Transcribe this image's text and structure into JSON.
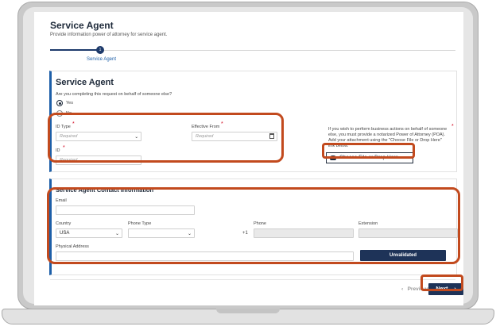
{
  "page": {
    "title": "Service Agent",
    "subtitle": "Provide information power of attorney for service agent."
  },
  "stepper": {
    "step_number": "1",
    "step_label": "Service Agent"
  },
  "service_agent": {
    "title": "Service Agent",
    "question": "Are you completing this request on behalf of someone else?",
    "option_yes": "Yes",
    "option_no": "No",
    "selected": "Yes",
    "id_type_label": "ID Type",
    "id_type_placeholder": "Required",
    "effective_from_label": "Effective From",
    "effective_from_placeholder": "Required",
    "id_label": "ID",
    "id_placeholder": "Required",
    "poa_text": "If you wish to perform business actions on behalf of someone else, you must provide a notarized Power of Attorney (POA). Add your attachment using the \"Choose File or Drop Here\" link below.",
    "upload_label": "Choose File or Drop Here",
    "required_mark": "*"
  },
  "contact": {
    "title": "Service Agent Contact Information",
    "email_label": "Email",
    "country_label": "Country",
    "country_value": "USA",
    "phone_type_label": "Phone Type",
    "phone_prefix": "+1",
    "phone_label": "Phone",
    "extension_label": "Extension",
    "address_label": "Physical Address",
    "unvalidated_label": "Unvalidated"
  },
  "footer": {
    "previous_label": "Previous",
    "next_label": "Next"
  },
  "colors": {
    "accent": "#1d5fa8",
    "dark_button": "#1e3358",
    "highlight": "#c24a1e",
    "required": "#d0021b"
  },
  "icons": [
    "chevron-down-icon",
    "calendar-icon",
    "cloud-upload-icon",
    "chevron-left-icon",
    "chevron-right-icon"
  ]
}
